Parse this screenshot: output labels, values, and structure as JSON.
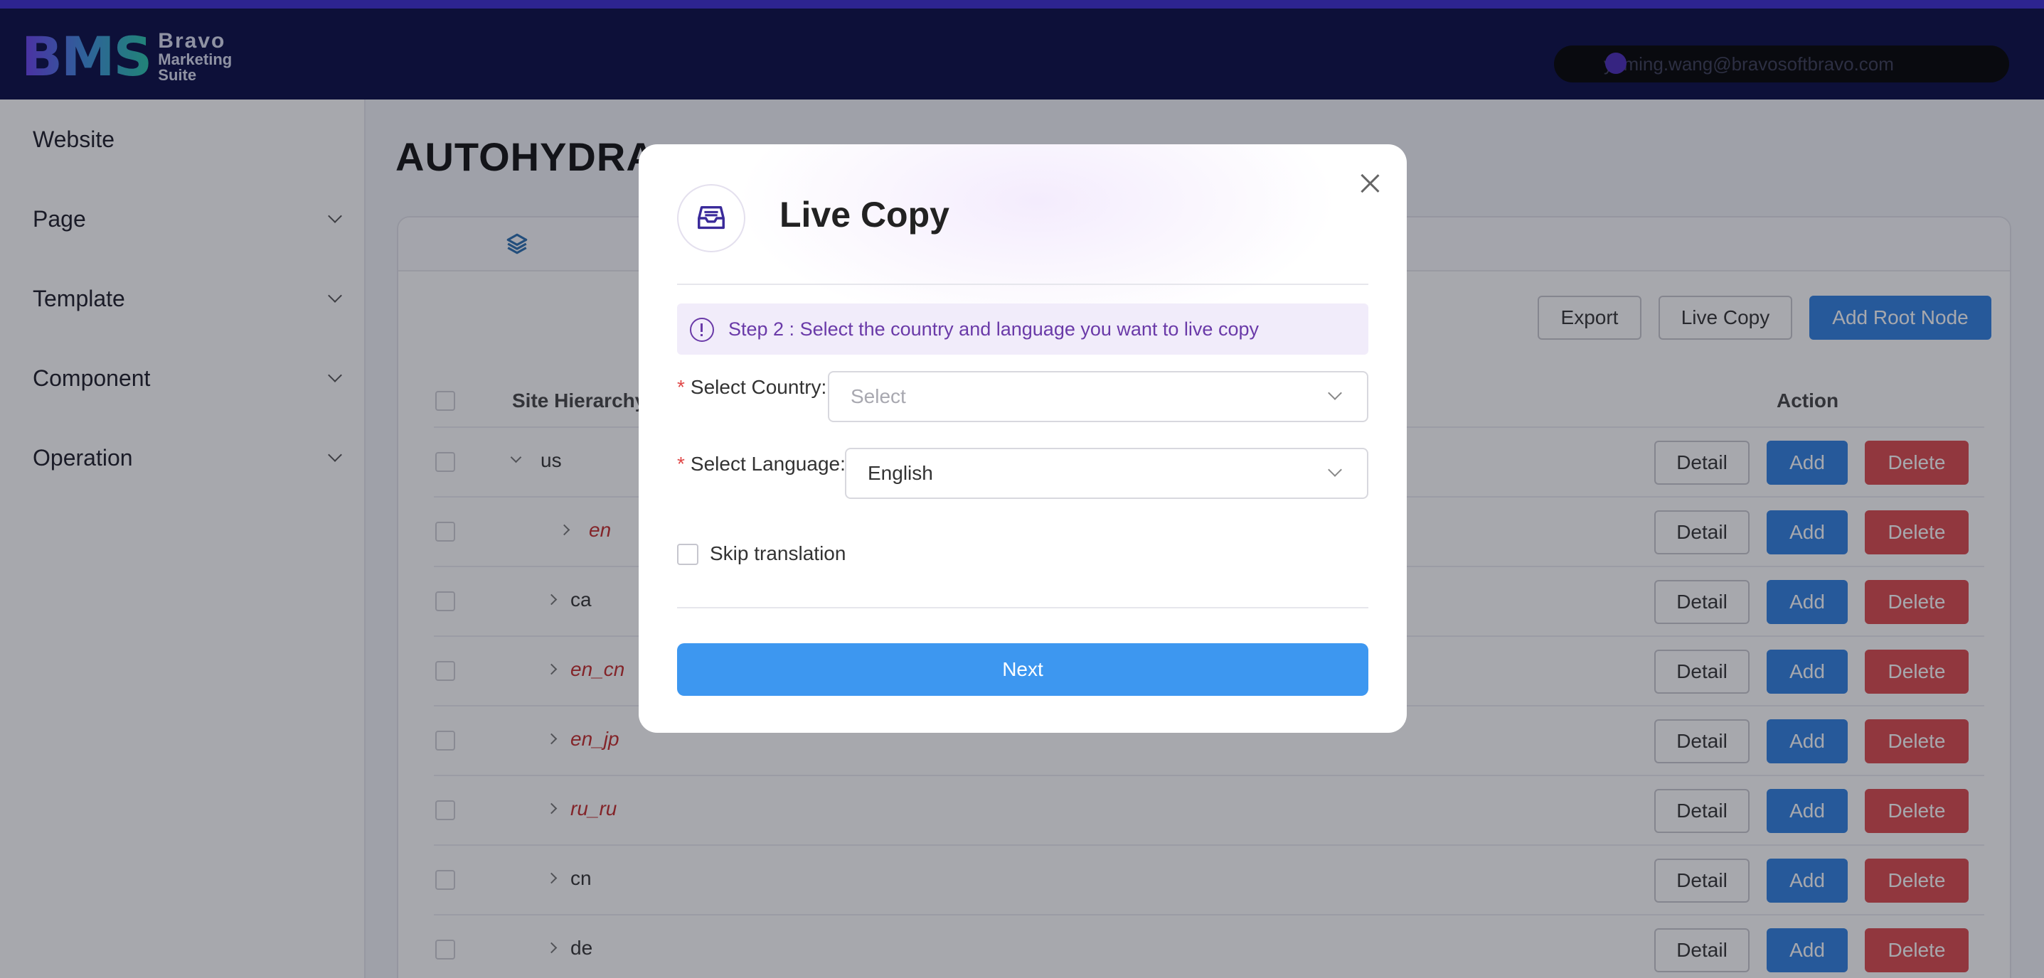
{
  "header": {
    "logo_mark": "BMS",
    "logo_line1": "Bravo",
    "logo_line2": "Marketing",
    "logo_line3": "Suite",
    "user_email": "yuming.wang@bravosoftbravo.com"
  },
  "sidebar": {
    "items": [
      {
        "label": "Website"
      },
      {
        "label": "Page"
      },
      {
        "label": "Template"
      },
      {
        "label": "Component"
      },
      {
        "label": "Operation"
      }
    ]
  },
  "main": {
    "title": "AUTOHYDRA",
    "toolbar": {
      "export_label": "Export",
      "live_copy_label": "Live Copy",
      "add_root_label": "Add Root Node"
    },
    "table": {
      "columns": {
        "hierarchy": "Site Hierarchy",
        "action": "Action"
      },
      "rows": [
        {
          "label": "us",
          "expanded": true
        },
        {
          "label": "en",
          "expanded": false
        },
        {
          "label": "ca",
          "expanded": false
        },
        {
          "label": "en_cn",
          "expanded": false
        },
        {
          "label": "en_jp",
          "expanded": false
        },
        {
          "label": "ru_ru",
          "expanded": false
        },
        {
          "label": "cn",
          "expanded": false
        },
        {
          "label": "de",
          "expanded": false
        }
      ],
      "actions": {
        "detail": "Detail",
        "add": "Add",
        "delete": "Delete"
      }
    }
  },
  "modal": {
    "title": "Live Copy",
    "alert": "Step 2 : Select the country and language you want to live copy",
    "country_label": "Select Country:",
    "country_placeholder": "Select",
    "language_label": "Select Language:",
    "language_value": "English",
    "required_mark": "*",
    "skip_label": "Skip translation",
    "next_label": "Next"
  },
  "colors": {
    "header_bg": "#070b44",
    "primary": "#2f80e0",
    "danger": "#dc4a4d",
    "modal_accent": "#6a3aa8",
    "next_button": "#3d97f0"
  }
}
